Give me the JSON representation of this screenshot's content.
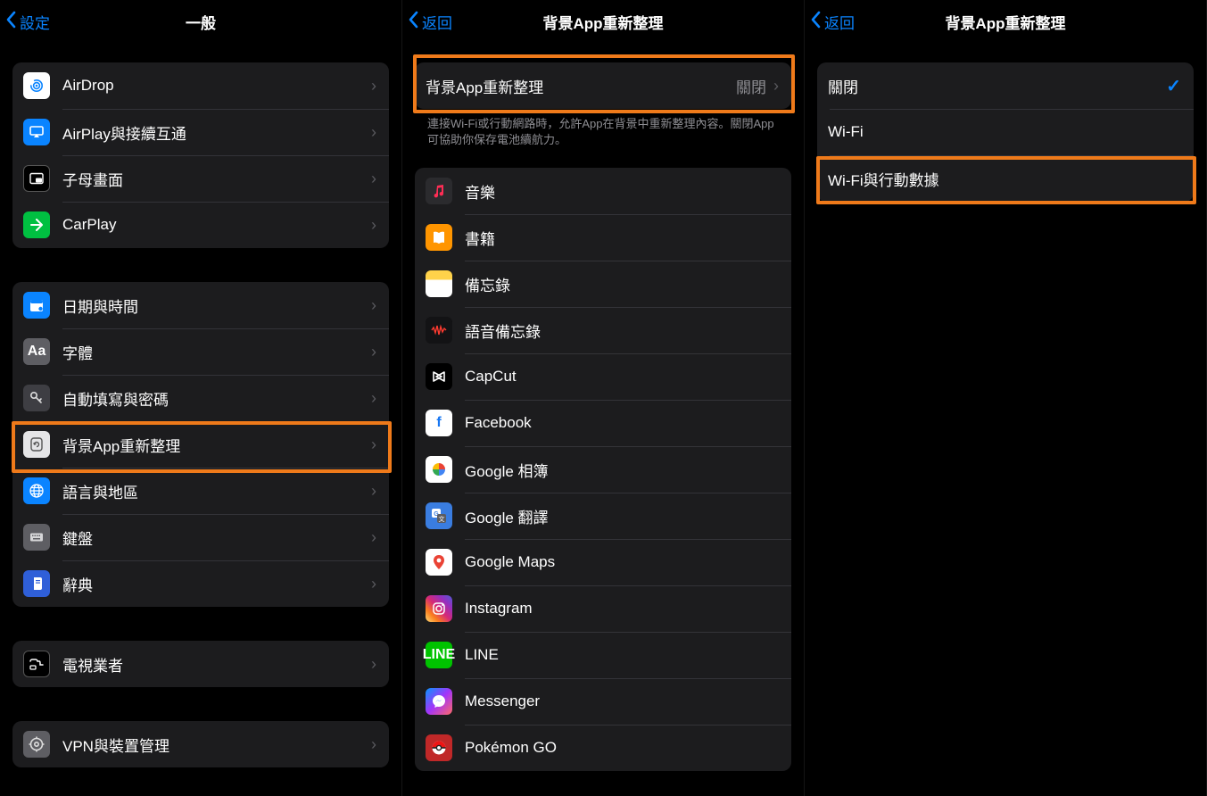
{
  "panel1": {
    "back": "設定",
    "title": "一般",
    "groups": [
      [
        {
          "label": "AirDrop",
          "icon": "airdrop"
        },
        {
          "label": "AirPlay與接續互通",
          "icon": "airplay"
        },
        {
          "label": "子母畫面",
          "icon": "pip"
        },
        {
          "label": "CarPlay",
          "icon": "carplay"
        }
      ],
      [
        {
          "label": "日期與時間",
          "icon": "date"
        },
        {
          "label": "字體",
          "icon": "font"
        },
        {
          "label": "自動填寫與密碼",
          "icon": "autofill"
        },
        {
          "label": "背景App重新整理",
          "icon": "bgrefresh",
          "highlighted": true
        },
        {
          "label": "語言與地區",
          "icon": "lang"
        },
        {
          "label": "鍵盤",
          "icon": "keyboard"
        },
        {
          "label": "辭典",
          "icon": "dict"
        }
      ],
      [
        {
          "label": "電視業者",
          "icon": "tv"
        }
      ],
      [
        {
          "label": "VPN與裝置管理",
          "icon": "vpn"
        }
      ]
    ]
  },
  "panel2": {
    "back": "返回",
    "title": "背景App重新整理",
    "setting": {
      "label": "背景App重新整理",
      "value": "關閉",
      "highlighted": true
    },
    "footer": "連接Wi-Fi或行動網路時，允許App在背景中重新整理內容。關閉App可協助你保存電池續航力。",
    "apps": [
      {
        "label": "音樂",
        "icon": "music"
      },
      {
        "label": "書籍",
        "icon": "books"
      },
      {
        "label": "備忘錄",
        "icon": "notes"
      },
      {
        "label": "語音備忘錄",
        "icon": "voicememo"
      },
      {
        "label": "CapCut",
        "icon": "capcut"
      },
      {
        "label": "Facebook",
        "icon": "facebook"
      },
      {
        "label": "Google 相簿",
        "icon": "gphotos"
      },
      {
        "label": "Google 翻譯",
        "icon": "gtranslate"
      },
      {
        "label": "Google Maps",
        "icon": "gmaps"
      },
      {
        "label": "Instagram",
        "icon": "instagram"
      },
      {
        "label": "LINE",
        "icon": "line"
      },
      {
        "label": "Messenger",
        "icon": "messenger"
      },
      {
        "label": "Pokémon GO",
        "icon": "pokemon"
      }
    ]
  },
  "panel3": {
    "back": "返回",
    "title": "背景App重新整理",
    "options": [
      {
        "label": "關閉",
        "checked": true
      },
      {
        "label": "Wi-Fi",
        "checked": false
      },
      {
        "label": "Wi-Fi與行動數據",
        "checked": false,
        "highlighted": true
      }
    ]
  }
}
